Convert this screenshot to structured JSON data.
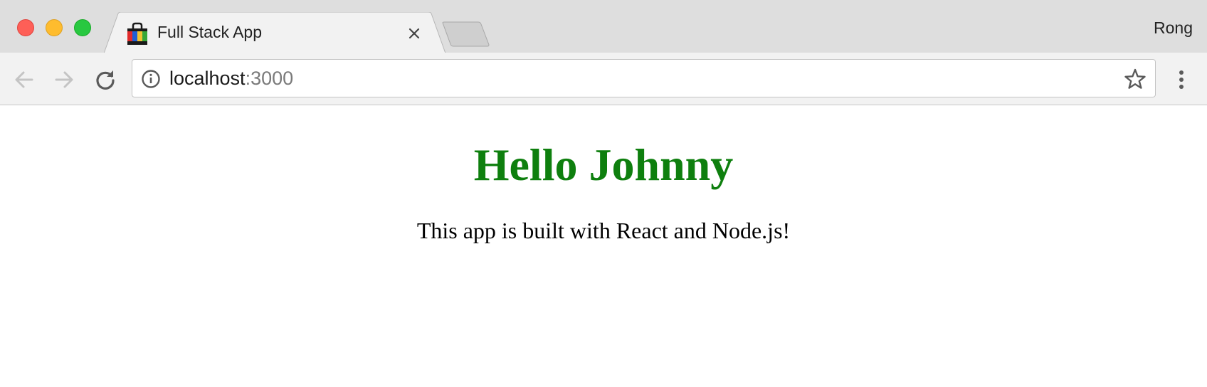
{
  "window": {
    "profile_name": "Rong"
  },
  "tabs": [
    {
      "title": "Full Stack App",
      "favicon": "shopping-bag-icon",
      "active": true
    }
  ],
  "toolbar": {
    "back_icon": "arrow-left-icon",
    "forward_icon": "arrow-right-icon",
    "reload_icon": "reload-icon",
    "menu_icon": "vertical-ellipsis-icon"
  },
  "omnibox": {
    "info_icon": "info-icon",
    "url_host": "localhost",
    "url_port": ":3000",
    "bookmark_icon": "star-icon"
  },
  "page": {
    "heading": "Hello Johnny",
    "heading_color": "#0e7f0e",
    "subtitle": "This app is built with React and Node.js!"
  }
}
